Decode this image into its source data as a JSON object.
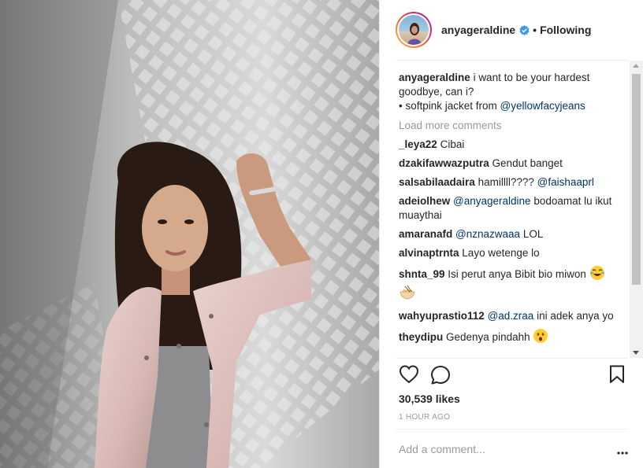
{
  "header": {
    "username": "anyageraldine",
    "separator": "•",
    "follow_status": "Following"
  },
  "caption": {
    "username": "anyageraldine",
    "text_line1": "i want to be your hardest goodbye, can i?",
    "text_line2_prefix": "• softpink jacket from ",
    "mention": "@yellowfacyjeans"
  },
  "load_more": "Load more comments",
  "comments": [
    {
      "user": "_leya22",
      "mention": "",
      "text": "Cibai"
    },
    {
      "user": "dzakifawwazputra",
      "mention": "",
      "text": "Gendut banget"
    },
    {
      "user": "salsabilaadaira",
      "mention": "",
      "text": "hamillll???? ",
      "mention_after": "@faishaaprl"
    },
    {
      "user": "adeiolhew",
      "mention": "@anyageraldine",
      "text": " bodoamat lu ikut muaythai"
    },
    {
      "user": "amaranafd",
      "mention": "@nznazwaaa",
      "text": " LOL"
    },
    {
      "user": "alvinaptrnta",
      "mention": "",
      "text": "Layo wetenge lo"
    },
    {
      "user": "shnta_99",
      "mention": "",
      "text": "Isi perut anya Bibit bio miwon "
    },
    {
      "user": "wahyuprastio112",
      "mention": "@ad.zraa",
      "text": " ini adek anya yo"
    },
    {
      "user": "theydipu",
      "mention": "",
      "text": "Gedenya pindahh "
    }
  ],
  "likes": "30,539 likes",
  "time": "1 HOUR AGO",
  "add_comment_placeholder": "Add a comment...",
  "more_label": "•••",
  "icons": [
    "heart-icon",
    "comment-icon",
    "bookmark-icon",
    "verified-badge-icon",
    "laughing-emoji",
    "noodle-emoji",
    "surprised-emoji",
    "more-options-icon"
  ],
  "colors": {
    "mention": "#003569",
    "muted": "#999999",
    "verified": "#3897f0",
    "border": "#efefef"
  }
}
